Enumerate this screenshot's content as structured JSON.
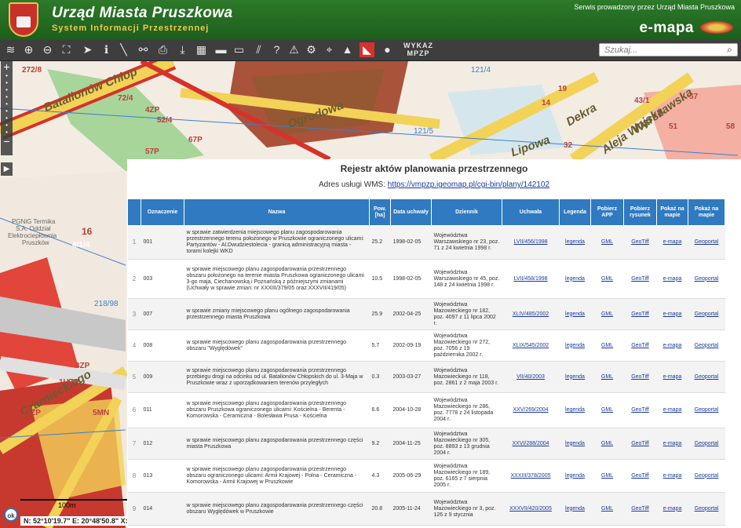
{
  "header": {
    "title": "Urząd Miasta Pruszkowa",
    "subtitle": "System Informacji Przestrzennej",
    "service": "Serwis prowadzony przez Urząd Miasta Pruszkowa",
    "brand": "e-mapa"
  },
  "toolbar": {
    "wykaz_line1": "WYKAZ",
    "wykaz_line2": "MPZP",
    "search_placeholder": "Szukaj..."
  },
  "map": {
    "streets": [
      "Batalionów Chłop",
      "Ogrodowa",
      "Dekra",
      "Aleja Wojska",
      "Warszawska",
      "Lipowa",
      "Czarnieckiego"
    ],
    "labels": [
      "272/8",
      "72/4",
      "4ZP",
      "52/4",
      "57P",
      "67P",
      "PGNiG Termika",
      "S.A. Oddział",
      "Elektrociepłownia",
      "Pruszków",
      "16",
      "4/1/4",
      "218/98",
      "3ZP",
      "1UZP",
      "12ZP",
      "5MN",
      "121/4",
      "57",
      "14",
      "19",
      "51",
      "43/1",
      "58",
      "121/5",
      "32"
    ],
    "scale_label": "100m",
    "coords": "N: 52°10'19.7\"  E: 20°48'50.8\"  X:",
    "ok": "ok"
  },
  "panel": {
    "title": "Rejestr aktów planowania przestrzennego",
    "wms_label": "Adres usługi WMS:",
    "wms_url": "https://vmpzp.igeomap.pl/cgi-bin/plany/142102",
    "columns": [
      "",
      "Oznaczenie",
      "Nazwa",
      "Pow. [ha]",
      "Data uchwały",
      "Dziennik",
      "Uchwała",
      "Legenda",
      "Pobierz APP",
      "Pobierz rysunek",
      "Pokaż na mapie",
      "Pokaż na mapie"
    ],
    "rows": [
      {
        "no": "1",
        "id": "001",
        "name": "w sprawie zatwierdzenia miejscowego planu zagospodarowania przestrzennego terenu położonego w Pruszkowie ograniczonego ulicami: Partyzantów - Al.Dwudziestolecia - granicą administracyjną miasta - torami kolejki WKD",
        "area": "25.2",
        "date": "1998-02-05",
        "journal": "Województwa Warszawskiego nr 23, poz. 71 z 24 kwietnia 1998 r.",
        "act": "LVII/456/1998",
        "legend": "legenda",
        "app": "GML",
        "drawing": "GeoTiff",
        "emapa": "e-mapa",
        "geoportal": "Geoportal"
      },
      {
        "no": "2",
        "id": "003",
        "name": "w sprawie miejscowego planu zagospodarowania przestrzennego obszaru położonego na terenie miasta Pruszkowa ograniczonego ulicami 3-go maja, Ciechanowską i Poznańską z późniejszymi zmianami (Uchwały w sprawie zmian: nr XXXIII/379/05 oraz XXXVII/419/05)",
        "area": "10.5",
        "date": "1998-02-05",
        "journal": "Województwa Warszawskiego nr 45, poz. 148 z 24 kwietnia 1998 r.",
        "act": "LVII/458/1998",
        "legend": "legenda",
        "app": "GML",
        "drawing": "GeoTiff",
        "emapa": "e-mapa",
        "geoportal": "Geoportal"
      },
      {
        "no": "3",
        "id": "007",
        "name": "w sprawie zmiany miejscowego planu ogólnego zagospodarowania przestrzennego miasta Pruszkowa",
        "area": "25.9",
        "date": "2002-04-25",
        "journal": "Województwa Mazowieckiego nr 182, poz. 4097 z 11 lipca 2002 r.",
        "act": "XLIV/485/2002",
        "legend": "legenda",
        "app": "GML",
        "drawing": "GeoTiff",
        "emapa": "e-mapa",
        "geoportal": "Geoportal"
      },
      {
        "no": "4",
        "id": "008",
        "name": "w sprawie miejscowego planu zagospodarowania przestrzennego obszaru \"Wyględówek\"",
        "area": "5.7",
        "date": "2002-09-19",
        "journal": "Województwa Mazowieckiego nr 272, poz. 7056 z 19 października 2002 r.",
        "act": "XLIX/545/2002",
        "legend": "legenda",
        "app": "GML",
        "drawing": "GeoTiff",
        "emapa": "e-mapa",
        "geoportal": "Geoportal"
      },
      {
        "no": "5",
        "id": "009",
        "name": "w sprawie miejscowego planu zagospodarowania przestrzennego przebiegu drogi na odcinku od ul. Batalionów Chłopskich do ul. 3-Maja w Pruszkowie wraz z uporządkowaniem terenów przyległych",
        "area": "0.3",
        "date": "2003-03-27",
        "journal": "Województwa Mazowieckiego nr 118, poz. 2861 z 2 maja 2003 r.",
        "act": "VII/40/2003",
        "legend": "legenda",
        "app": "GML",
        "drawing": "GeoTiff",
        "emapa": "e-mapa",
        "geoportal": "Geoportal"
      },
      {
        "no": "6",
        "id": "011",
        "name": "w sprawie miejscowego planu zagospodarowania przestrzennego obszaru Pruszkowa ograniczonego ulicami: Kościelna - Berenta - Komorowska - Ceramiczna - Bolesława Prusa - Kościelna",
        "area": "6.6",
        "date": "2004-10-28",
        "journal": "Województwa Mazowieckiego nr 286, poz. 7778 z 24 listopada 2004 r.",
        "act": "XXV/269/2004",
        "legend": "legenda",
        "app": "GML",
        "drawing": "GeoTiff",
        "emapa": "e-mapa",
        "geoportal": "Geoportal"
      },
      {
        "no": "7",
        "id": "012",
        "name": "w sprawie miejscowego planu zagospodarowania przestrzennego części miasta Pruszkowa",
        "area": "9.2",
        "date": "2004-11-25",
        "journal": "Województwa Mazowieckiego nr 305, poz. 8893 z 13 grudnia 2004 r.",
        "act": "XXVI/288/2004",
        "legend": "legenda",
        "app": "GML",
        "drawing": "GeoTiff",
        "emapa": "e-mapa",
        "geoportal": "Geoportal"
      },
      {
        "no": "8",
        "id": "013",
        "name": "w sprawie miejscowego planu zagospodarowania przestrzennego obszaru ograniczonego ulicami: Armii Krajowej - Polna - Ceramiczna - Komorowska - Armii Krajowej w Pruszkowie",
        "area": "4.3",
        "date": "2005-06-29",
        "journal": "Województwa Mazowieckiego nr 189, poz. 6165 z 7 sierpnia 2005 r.",
        "act": "XXXIII/378/2005",
        "legend": "legenda",
        "app": "GML",
        "drawing": "GeoTiff",
        "emapa": "e-mapa",
        "geoportal": "Geoportal"
      },
      {
        "no": "9",
        "id": "014",
        "name": "w sprawie miejscowego planu zagospodarowania przestrzennego części obszaru Wyględówek w Pruszkowie",
        "area": "20.8",
        "date": "2005-11-24",
        "journal": "Województwa Mazowieckiego nr 3, poz. 126 z 9 stycznia",
        "act": "XXXVII/420/2005",
        "legend": "legenda",
        "app": "GML",
        "drawing": "GeoTiff",
        "emapa": "e-mapa",
        "geoportal": "Geoportal"
      }
    ]
  },
  "colors": {
    "header_green": "#1d5e1c",
    "table_header": "#2f7ac0",
    "link": "#1a3a9c",
    "road_yellow": "#f2d257",
    "road_red": "#d6322b"
  }
}
